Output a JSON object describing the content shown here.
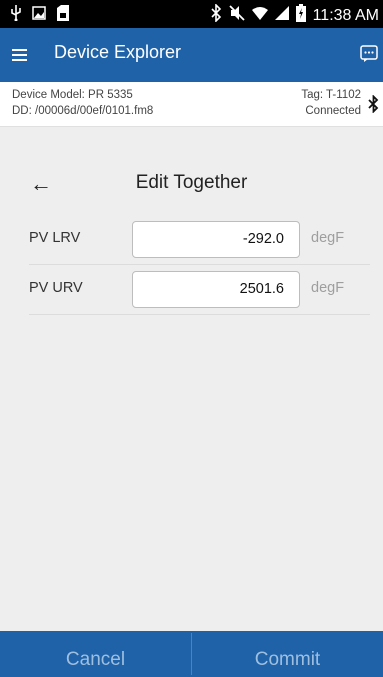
{
  "status_bar": {
    "time": "11:38 AM",
    "icons": [
      "usb-icon",
      "image-icon",
      "storage-icon",
      "bluetooth-icon",
      "mute-icon",
      "wifi-icon",
      "signal-icon",
      "battery-icon"
    ]
  },
  "app_bar": {
    "menu_icon": "hamburger-menu-icon",
    "title": "Device Explorer",
    "action_icon": "chat-bubble-icon"
  },
  "device_info": {
    "model": "Device Model: PR 5335",
    "dd": "DD: /00006d/00ef/0101.fm8",
    "tag": "Tag: T-1102",
    "status": "Connected",
    "status_icon": "bluetooth-icon"
  },
  "page": {
    "back_glyph": "←",
    "title": "Edit Together"
  },
  "fields": [
    {
      "label": "PV LRV",
      "value": "-292.0",
      "unit": "degF"
    },
    {
      "label": "PV URV",
      "value": "2501.6",
      "unit": "degF"
    }
  ],
  "actions": {
    "cancel": "Cancel",
    "commit": "Commit"
  },
  "colors": {
    "primary": "#1f62a8",
    "background": "#eeeeee",
    "action_text_disabled": "#9fbfe0"
  }
}
